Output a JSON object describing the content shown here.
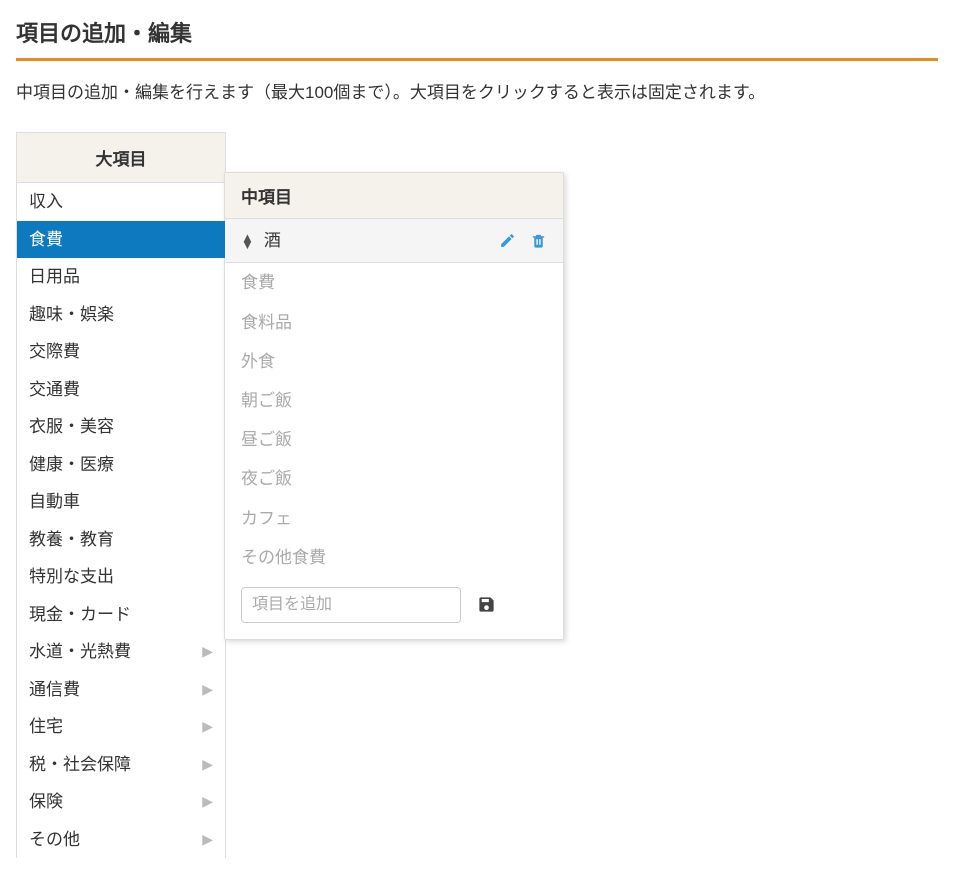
{
  "page": {
    "title": "項目の追加・編集",
    "description": "中項目の追加・編集を行えます（最大100個まで）。大項目をクリックすると表示は固定されます。"
  },
  "main_panel": {
    "header": "大項目",
    "items": [
      {
        "label": "収入",
        "has_sub": false,
        "selected": false
      },
      {
        "label": "食費",
        "has_sub": false,
        "selected": true
      },
      {
        "label": "日用品",
        "has_sub": false,
        "selected": false
      },
      {
        "label": "趣味・娯楽",
        "has_sub": false,
        "selected": false
      },
      {
        "label": "交際費",
        "has_sub": false,
        "selected": false
      },
      {
        "label": "交通費",
        "has_sub": false,
        "selected": false
      },
      {
        "label": "衣服・美容",
        "has_sub": false,
        "selected": false
      },
      {
        "label": "健康・医療",
        "has_sub": false,
        "selected": false
      },
      {
        "label": "自動車",
        "has_sub": false,
        "selected": false
      },
      {
        "label": "教養・教育",
        "has_sub": false,
        "selected": false
      },
      {
        "label": "特別な支出",
        "has_sub": false,
        "selected": false
      },
      {
        "label": "現金・カード",
        "has_sub": false,
        "selected": false
      },
      {
        "label": "水道・光熱費",
        "has_sub": true,
        "selected": false
      },
      {
        "label": "通信費",
        "has_sub": true,
        "selected": false
      },
      {
        "label": "住宅",
        "has_sub": true,
        "selected": false
      },
      {
        "label": "税・社会保障",
        "has_sub": true,
        "selected": false
      },
      {
        "label": "保険",
        "has_sub": true,
        "selected": false
      },
      {
        "label": "その他",
        "has_sub": true,
        "selected": false
      }
    ]
  },
  "sub_panel": {
    "header": "中項目",
    "custom_item": {
      "label": "酒"
    },
    "default_items": [
      "食費",
      "食料品",
      "外食",
      "朝ご飯",
      "昼ご飯",
      "夜ご飯",
      "カフェ",
      "その他食費"
    ],
    "add_placeholder": "項目を追加"
  }
}
